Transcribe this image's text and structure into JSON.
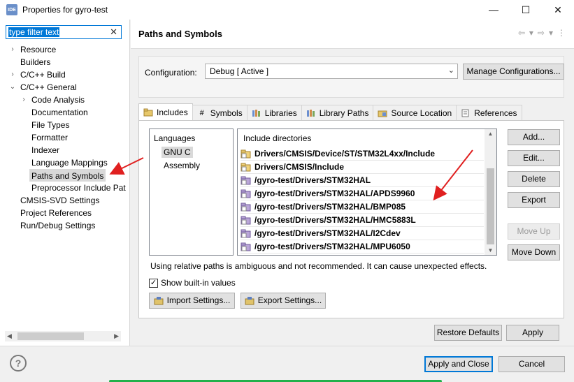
{
  "window": {
    "app_icon_text": "IDE",
    "title": "Properties for gyro-test",
    "controls": {
      "minimize": "—",
      "maximize": "☐",
      "close": "✕"
    }
  },
  "filter": {
    "value": "type filter text",
    "clear_icon": "✕"
  },
  "tree": [
    {
      "label": "Resource",
      "level": 0,
      "arrow": "›"
    },
    {
      "label": "Builders",
      "level": 0,
      "arrow": ""
    },
    {
      "label": "C/C++ Build",
      "level": 0,
      "arrow": "›"
    },
    {
      "label": "C/C++ General",
      "level": 0,
      "arrow": "⌄"
    },
    {
      "label": "Code Analysis",
      "level": 1,
      "arrow": "›"
    },
    {
      "label": "Documentation",
      "level": 1,
      "arrow": ""
    },
    {
      "label": "File Types",
      "level": 1,
      "arrow": ""
    },
    {
      "label": "Formatter",
      "level": 1,
      "arrow": ""
    },
    {
      "label": "Indexer",
      "level": 1,
      "arrow": ""
    },
    {
      "label": "Language Mappings",
      "level": 1,
      "arrow": ""
    },
    {
      "label": "Paths and Symbols",
      "level": 1,
      "arrow": "",
      "selected": true
    },
    {
      "label": "Preprocessor Include Pat",
      "level": 1,
      "arrow": ""
    },
    {
      "label": "CMSIS-SVD Settings",
      "level": 0,
      "arrow": ""
    },
    {
      "label": "Project References",
      "level": 0,
      "arrow": ""
    },
    {
      "label": "Run/Debug Settings",
      "level": 0,
      "arrow": ""
    }
  ],
  "page": {
    "title": "Paths and Symbols",
    "nav": {
      "back": "⇦",
      "back_menu": "▾",
      "forward": "⇨",
      "forward_menu": "▾",
      "more": "⋮"
    }
  },
  "configuration": {
    "label": "Configuration:",
    "value": "Debug  [ Active ]",
    "manage_label": "Manage Configurations..."
  },
  "tabs": [
    {
      "label": "Includes",
      "icon": "folder-include-icon",
      "active": true
    },
    {
      "label": "Symbols",
      "icon": "hash-icon"
    },
    {
      "label": "Libraries",
      "icon": "library-icon"
    },
    {
      "label": "Library Paths",
      "icon": "library-path-icon"
    },
    {
      "label": "Source Location",
      "icon": "source-folder-icon"
    },
    {
      "label": "References",
      "icon": "references-icon"
    }
  ],
  "languages": {
    "header": "Languages",
    "items": [
      {
        "label": "GNU C",
        "selected": true
      },
      {
        "label": "Assembly"
      }
    ]
  },
  "includes": {
    "header": "Include directories",
    "rows": [
      {
        "path": "Drivers/CMSIS/Device/ST/STM32L4xx/Include",
        "type": "folder"
      },
      {
        "path": "Drivers/CMSIS/Include",
        "type": "folder"
      },
      {
        "path": "/gyro-test/Drivers/STM32HAL",
        "type": "workspace"
      },
      {
        "path": "/gyro-test/Drivers/STM32HAL/APDS9960",
        "type": "workspace"
      },
      {
        "path": "/gyro-test/Drivers/STM32HAL/BMP085",
        "type": "workspace"
      },
      {
        "path": "/gyro-test/Drivers/STM32HAL/HMC5883L",
        "type": "workspace"
      },
      {
        "path": "/gyro-test/Drivers/STM32HAL/I2Cdev",
        "type": "workspace"
      },
      {
        "path": "/gyro-test/Drivers/STM32HAL/MPU6050",
        "type": "workspace"
      }
    ]
  },
  "side_buttons": {
    "add": "Add...",
    "edit": "Edit...",
    "delete": "Delete",
    "export": "Export",
    "move_up": "Move Up",
    "move_down": "Move Down"
  },
  "warning": "Using relative paths is ambiguous and not recommended. It can cause unexpected effects.",
  "show_builtin": {
    "label": "Show built-in values",
    "checked": true,
    "mark": "✓"
  },
  "import_label": "Import Settings...",
  "export_settings_label": "Export Settings...",
  "restore_defaults": "Restore Defaults",
  "apply": "Apply",
  "apply_and_close": "Apply and Close",
  "cancel": "Cancel",
  "help_icon": "?",
  "colors": {
    "accent": "#0078d7",
    "annotation_arrow": "#e02020",
    "progress_green": "#21b14b"
  }
}
